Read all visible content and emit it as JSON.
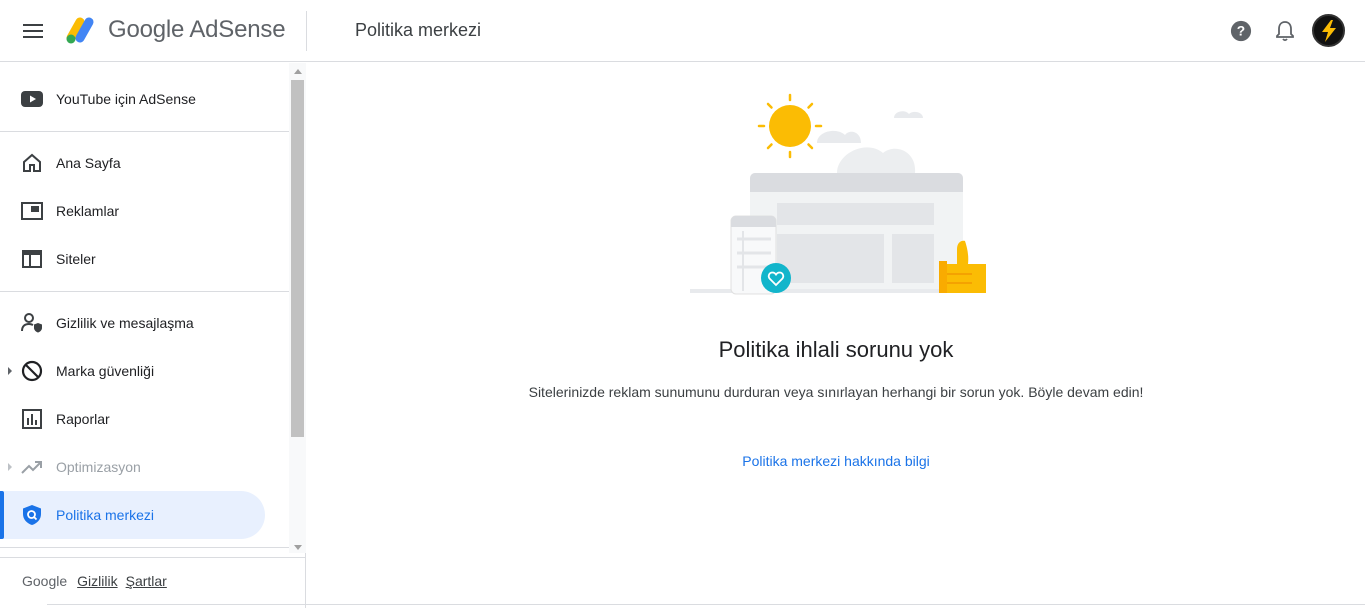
{
  "header": {
    "menu_icon": "hamburger-menu-icon",
    "logo_text": "Google AdSense",
    "page_title": "Politika merkezi",
    "help_icon": "help-icon",
    "notifications_icon": "bell-icon",
    "avatar_icon": "lightning-bolt-icon"
  },
  "sidebar": {
    "items": [
      {
        "label": "YouTube için AdSense",
        "icon": "youtube-icon"
      },
      {
        "label": "Ana Sayfa",
        "icon": "home-icon"
      },
      {
        "label": "Reklamlar",
        "icon": "ads-icon"
      },
      {
        "label": "Siteler",
        "icon": "sites-icon"
      },
      {
        "label": "Gizlilik ve mesajlaşma",
        "icon": "privacy-person-icon"
      },
      {
        "label": "Marka güvenliği",
        "icon": "block-icon"
      },
      {
        "label": "Raporlar",
        "icon": "reports-icon"
      },
      {
        "label": "Optimizasyon",
        "icon": "trending-up-icon"
      },
      {
        "label": "Politika merkezi",
        "icon": "policy-shield-icon"
      }
    ],
    "active_item": "Politika merkezi",
    "footer": {
      "brand": "Google",
      "privacy_link": "Gizlilik",
      "terms_link": "Şartlar"
    }
  },
  "main": {
    "illustration": "policy-ok-illustration",
    "title": "Politika ihlali sorunu yok",
    "description": "Sitelerinizde reklam sunumunu durduran veya sınırlayan herhangi bir sorun yok. Böyle devam edin!",
    "link_text": "Politika merkezi hakkında bilgi"
  },
  "colors": {
    "accent": "#1a73e8",
    "active_bg": "#e8f0fe",
    "sun": "#fbbc04",
    "teal_badge": "#12b5cb"
  }
}
